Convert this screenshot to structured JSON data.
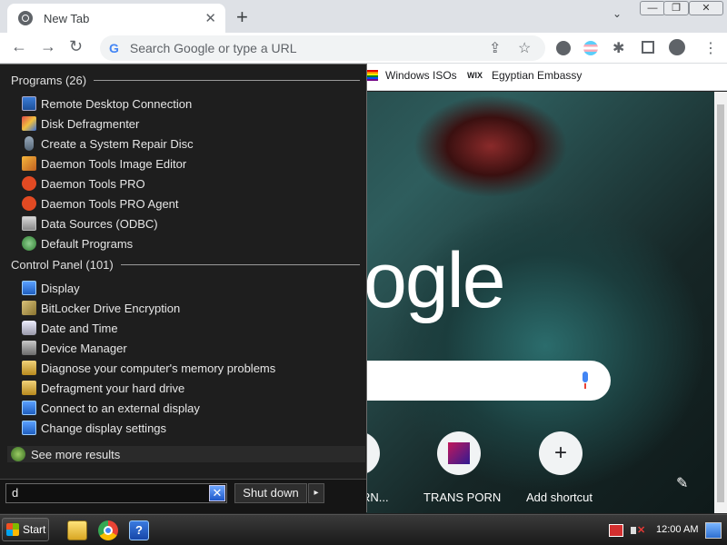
{
  "browser": {
    "tab_title": "New Tab",
    "tab_close": "✕",
    "new_tab": "+",
    "tab_search": "⌄",
    "window_buttons": [
      "—",
      "❐",
      "✕"
    ],
    "omnibox_placeholder": "Search Google or type a URL",
    "omnibox_g": "G",
    "bookmarks": [
      {
        "label": "Windows ISOs"
      },
      {
        "label": "Egyptian Embassy",
        "icon": "WIX"
      }
    ],
    "ntp": {
      "logo_fragment": "ogle",
      "shortcuts": [
        {
          "label": "RN..."
        },
        {
          "label": "TRANS PORN"
        },
        {
          "label": "Add shortcut",
          "icon": "+"
        }
      ]
    }
  },
  "start_menu": {
    "programs_header": "Programs (26)",
    "programs": [
      {
        "label": "Remote Desktop Connection",
        "icon": "rdp"
      },
      {
        "label": "Disk Defragmenter",
        "icon": "defrag"
      },
      {
        "label": "Create a System Repair Disc",
        "icon": "disc"
      },
      {
        "label": "Daemon Tools Image Editor",
        "icon": "daemon-ed"
      },
      {
        "label": "Daemon Tools PRO",
        "icon": "daemon"
      },
      {
        "label": "Daemon Tools PRO Agent",
        "icon": "daemon"
      },
      {
        "label": "Data Sources (ODBC)",
        "icon": "odbc"
      },
      {
        "label": "Default Programs",
        "icon": "default"
      }
    ],
    "control_panel_header": "Control Panel (101)",
    "control_panel": [
      {
        "label": "Display",
        "icon": "display"
      },
      {
        "label": "BitLocker Drive Encryption",
        "icon": "bitlocker"
      },
      {
        "label": "Date and Time",
        "icon": "date"
      },
      {
        "label": "Device Manager",
        "icon": "device"
      },
      {
        "label": "Diagnose your computer's memory problems",
        "icon": "memory"
      },
      {
        "label": "Defragment your hard drive",
        "icon": "defragdrive"
      },
      {
        "label": "Connect to an external display",
        "icon": "display"
      },
      {
        "label": "Change display settings",
        "icon": "display"
      }
    ],
    "see_more": "See more results",
    "search_value": "d",
    "clear": "✕",
    "shutdown": "Shut down",
    "shutdown_arrow": "▸"
  },
  "taskbar": {
    "start_label": "Start",
    "help": "?",
    "clock": "12:00 AM"
  }
}
